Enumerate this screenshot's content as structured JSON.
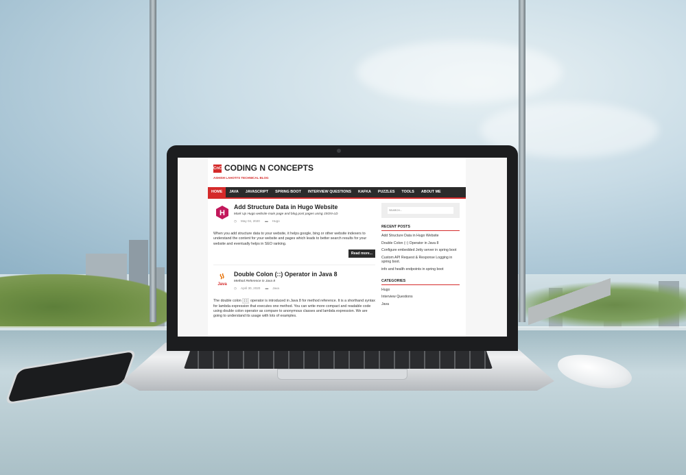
{
  "site": {
    "logo": "CnC",
    "title": "CODING N CONCEPTS",
    "tagline": "ASHISH LAHOTI'S TECHNICAL BLOG"
  },
  "nav": [
    "HOME",
    "JAVA",
    "JAVASCRIPT",
    "SPRING BOOT",
    "INTERVIEW QUESTIONS",
    "KAFKA",
    "PUZZLES",
    "TOOLS",
    "ABOUT ME"
  ],
  "posts": [
    {
      "icon": "hugo-icon",
      "icon_letter": "H",
      "title": "Add Structure Data in Hugo Website",
      "subtitle": "Mark Up Hugo website main page and blog post pages using JSON-LD",
      "date": "May 04, 2020",
      "category": "Hugo",
      "excerpt": "When you add structure data to your website, it helps google, bing or other website indexers to understand the content for your website and pages which leads to better search results for your website and eventually helps in SEO ranking.",
      "read_more": "Read more..."
    },
    {
      "icon": "java-icon",
      "icon_letter": "Java",
      "title": "Double Colon (::) Operator in Java 8",
      "subtitle": "Method Reference in Java 8",
      "date": "April 30, 2020",
      "category": "Java",
      "excerpt_pre": "The double colon",
      "excerpt_code": "::",
      "excerpt_post": "operator is introduced in Java 8 for method reference. It is a shorthand syntax for lambda expression that executes one method. You can write more compact and readable code using double colon operator as compare to anonymous classes and lambda expression. We are going to understand its usage with lots of examples."
    }
  ],
  "sidebar": {
    "search_placeholder": "SEARCH...",
    "recent_title": "RECENT POSTS",
    "recent_posts": [
      "Add Structure Data in Hugo Website",
      "Double Colon (::) Operator in Java 8",
      "Configure embedded Jetty server in spring boot",
      "Custom API Request & Response Logging in spring boot.",
      "info and health endpoints in spring boot"
    ],
    "categories_title": "CATEGORIES",
    "categories": [
      "Hugo",
      "Interview Questions",
      "Java"
    ]
  },
  "colors": {
    "accent": "#d42a2a",
    "nav_bg": "#2b2b2b"
  }
}
